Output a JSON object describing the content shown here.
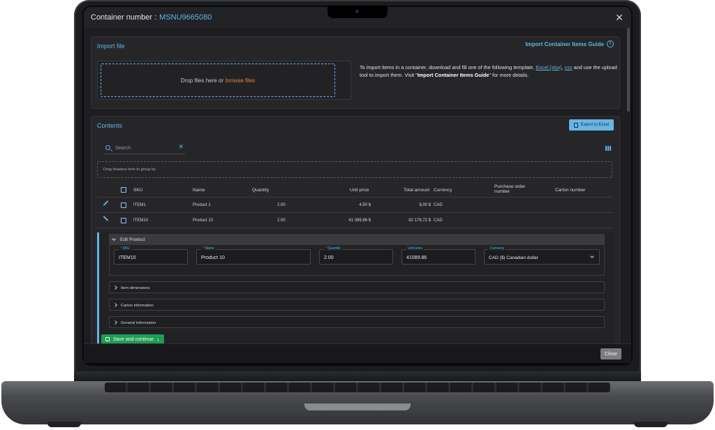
{
  "window": {
    "title_label": "Container number :",
    "container_number": "MSNU9665080"
  },
  "import": {
    "title": "Import file",
    "guide_link": "Import Container Items Guide",
    "drop_text": "Drop files here or",
    "browse_text": "browse files",
    "desc_1": "To import items in a container, download and fill one of the following template,",
    "desc_excel": "Excel (xlsx)",
    "desc_sep": ",",
    "desc_csv": "csv",
    "desc_2": "and use the upload tool to import them. Visit \"",
    "desc_guide": "Import Container Items Guide",
    "desc_3": "\" for more details."
  },
  "contents": {
    "title": "Contents",
    "export_label": "Export to Excel",
    "search_placeholder": "Search",
    "group_hint": "Drag headers here to group by",
    "columns": {
      "sku": "SKU",
      "name": "Name",
      "quantity": "Quantity",
      "unit_price": "Unit price",
      "total_amount": "Total amount",
      "currency": "Currency",
      "po_number_1": "Purchase order",
      "po_number_2": "number",
      "carton_number": "Carton number"
    },
    "rows": [
      {
        "sku": "ITEM1",
        "name": "Product 1",
        "quantity": "2.00",
        "unit_price": "4,50 $",
        "total_amount": "9,00 $",
        "currency": "CAD"
      },
      {
        "sku": "ITEM10",
        "name": "Product 10",
        "quantity": "2.00",
        "unit_price": "41 089,86 $",
        "total_amount": "82 179,72 $",
        "currency": "CAD"
      }
    ]
  },
  "edit": {
    "title": "Edit Product",
    "fields": {
      "sku_label": "SKU",
      "sku_value": "ITEM10",
      "name_label": "Name",
      "name_value": "Product 10",
      "quantity_label": "Quantity",
      "quantity_value": "2.00",
      "unit_price_label": "Unit price",
      "unit_price_value": "41089.86",
      "currency_label": "Currency",
      "currency_value": "CAD ($) Canadian dollar"
    },
    "sections": [
      "Item dimensions",
      "Carton information",
      "General Information"
    ],
    "save_label": "Save and continue"
  },
  "footer": {
    "close_label": "Close"
  },
  "colors": {
    "accent": "#5cb6e8",
    "save": "#1f9d55",
    "browse": "#f08030"
  }
}
